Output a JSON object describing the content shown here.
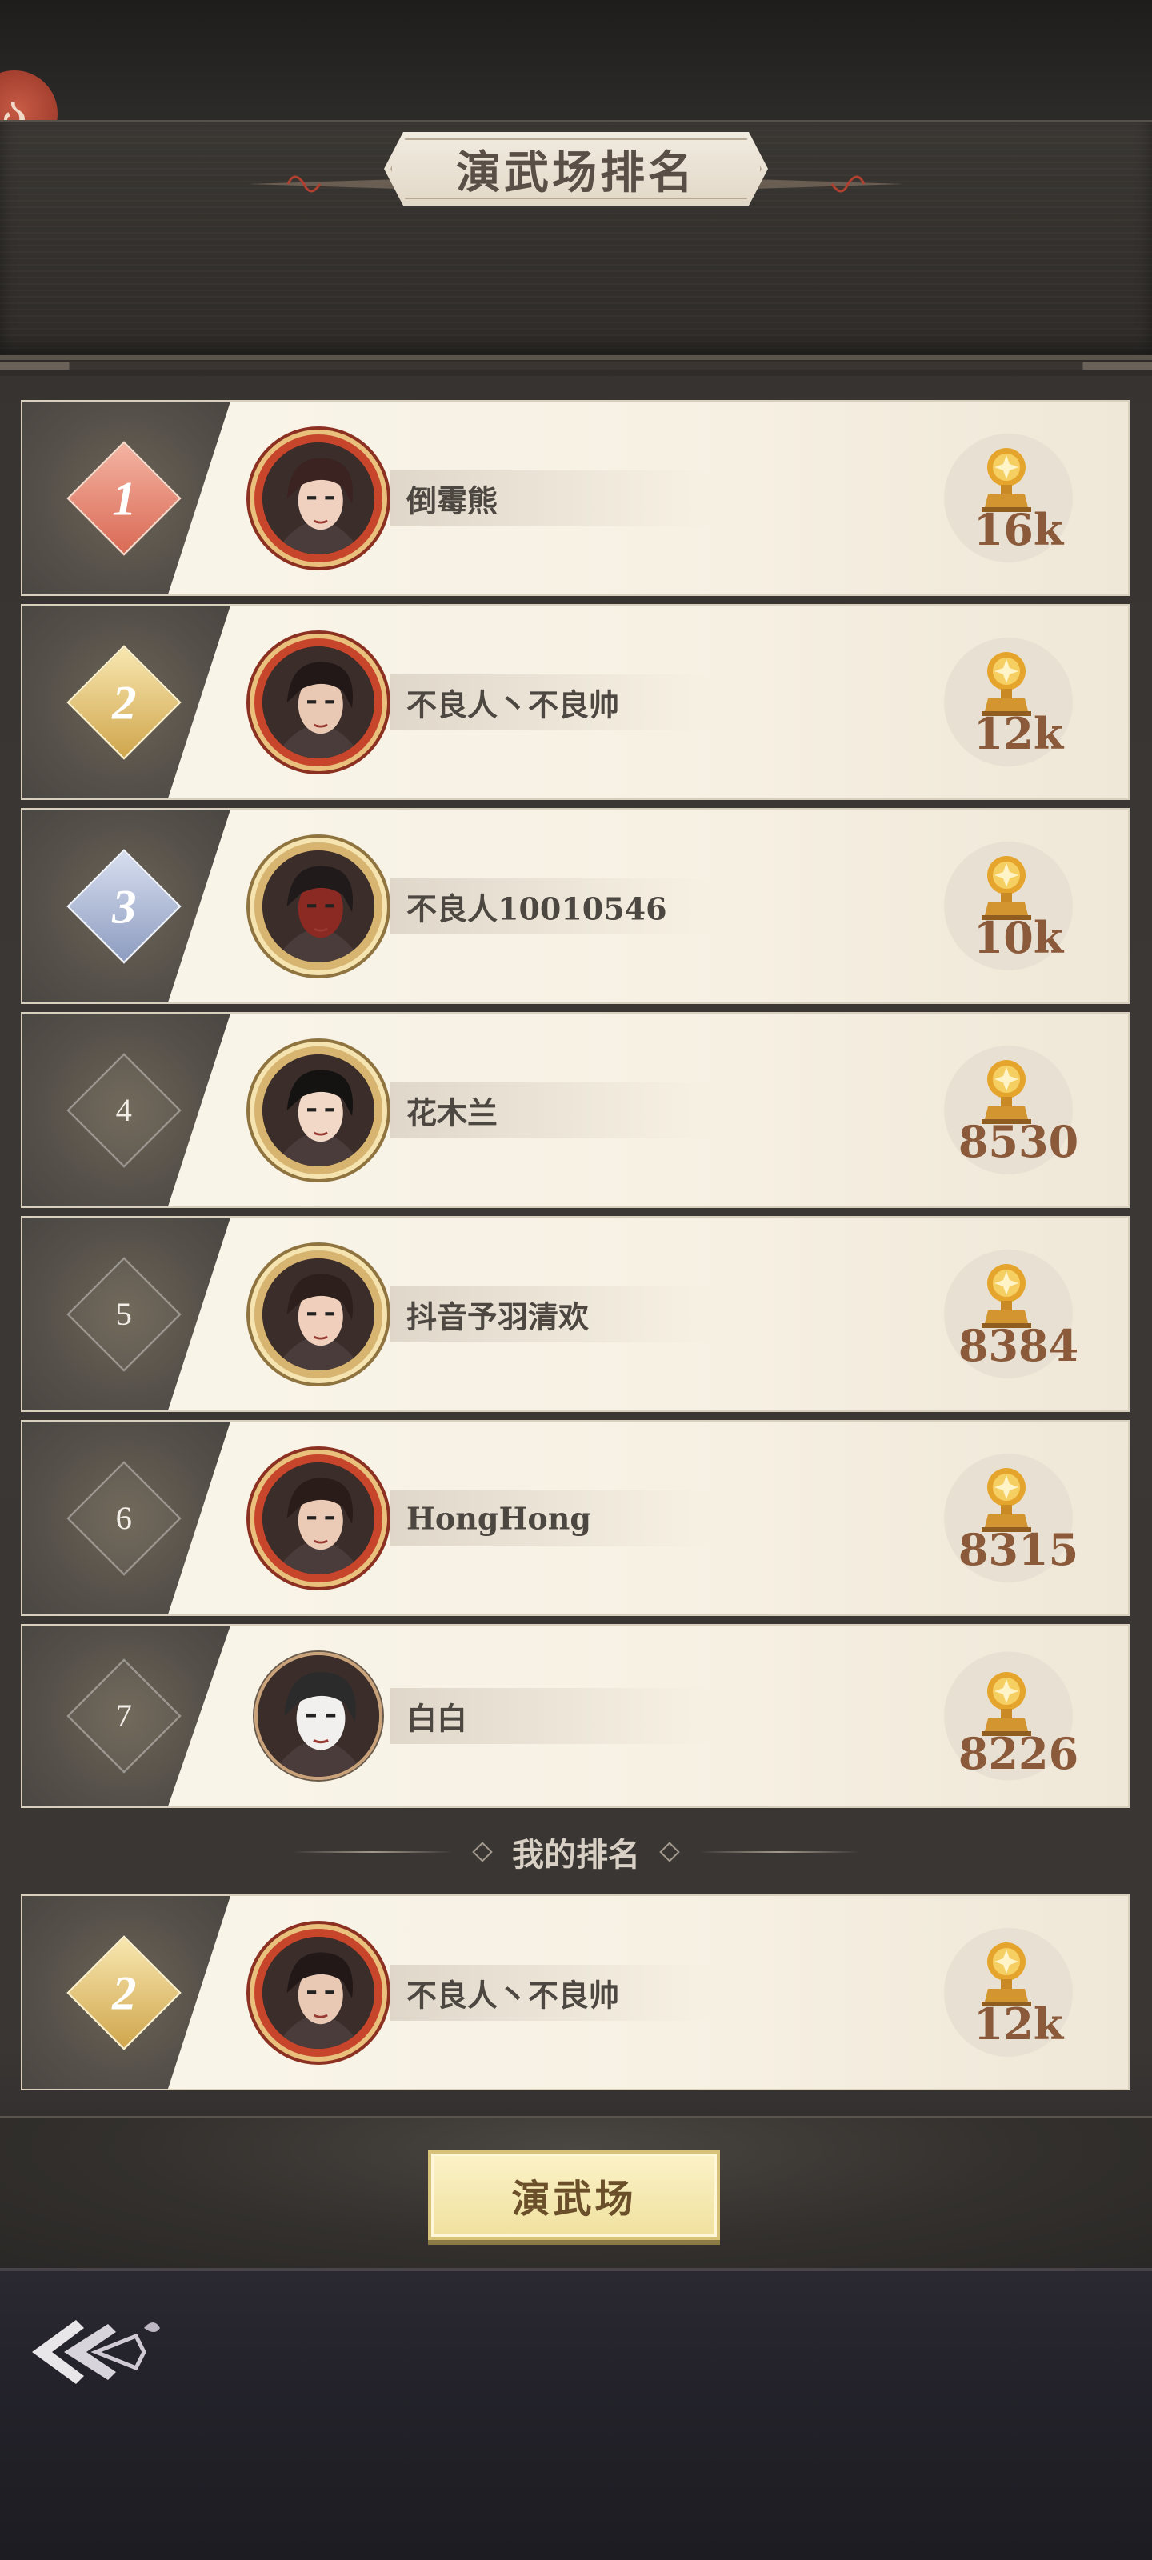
{
  "header": {
    "title": "演武场排名",
    "logo_glyph": "ა"
  },
  "ranking": [
    {
      "rank": "1",
      "style": "gold-1",
      "name": "倒霉熊",
      "score": "16k",
      "frame": "red",
      "hair": "#3a2320",
      "skin": "#f0d1c0"
    },
    {
      "rank": "2",
      "style": "gold-2",
      "name": "不良人丶不良帅",
      "score": "12k",
      "frame": "red",
      "hair": "#221818",
      "skin": "#e9c9b4"
    },
    {
      "rank": "3",
      "style": "gold-3",
      "name": "不良人10010546",
      "score": "10k",
      "frame": "gold",
      "hair": "#201a1a",
      "skin": "#8a2a22"
    },
    {
      "rank": "4",
      "style": "plain",
      "name": "花木兰",
      "score": "8530",
      "frame": "gold",
      "hair": "#151212",
      "skin": "#f1d8c7"
    },
    {
      "rank": "5",
      "style": "plain",
      "name": "抖音予羽清欢",
      "score": "8384",
      "frame": "gold",
      "hair": "#2d201c",
      "skin": "#f0d0bd"
    },
    {
      "rank": "6",
      "style": "plain",
      "name": "HongHong",
      "score": "8315",
      "frame": "red",
      "hair": "#2a1d19",
      "skin": "#eccbb6"
    },
    {
      "rank": "7",
      "style": "plain",
      "name": "白白",
      "score": "8226",
      "frame": "plain",
      "hair": "#2b2b2b",
      "skin": "#f2f0ee"
    }
  ],
  "my_rank": {
    "label": "我的排名",
    "entry": {
      "rank": "2",
      "style": "gold-2",
      "name": "不良人丶不良帅",
      "score": "12k",
      "frame": "red",
      "hair": "#221818",
      "skin": "#e9c9b4"
    }
  },
  "arena_button_label": "演武场",
  "icons": {
    "trophy": "trophy-icon",
    "back": "back-arrow-icon"
  },
  "colors": {
    "score_text": "#8a5a3a",
    "button_bg": "#f0e19e",
    "row_bg": "#faf5ea"
  }
}
